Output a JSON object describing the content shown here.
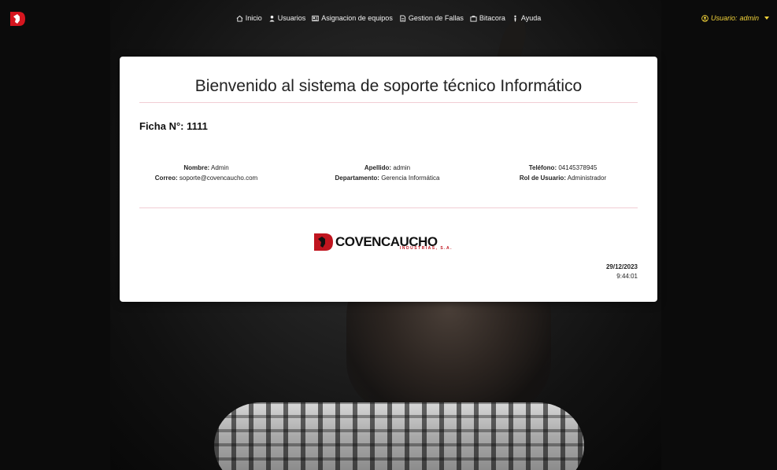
{
  "nav": {
    "items": [
      {
        "label": "Inicio",
        "icon": "home-icon"
      },
      {
        "label": "Usuarios",
        "icon": "user-icon"
      },
      {
        "label": "Asignacion de equipos",
        "icon": "id-card-icon"
      },
      {
        "label": "Gestion de Fallas",
        "icon": "document-icon"
      },
      {
        "label": "Bitacora",
        "icon": "briefcase-icon"
      },
      {
        "label": "Ayuda",
        "icon": "help-figure-icon"
      }
    ],
    "user": {
      "prefix": "Usuario:",
      "name": "admin"
    }
  },
  "card": {
    "title": "Bienvenido al sistema de soporte técnico Informático",
    "ficha": "Ficha N°: 1111",
    "fields": {
      "nombre_label": "Nombre:",
      "nombre": "Admin",
      "correo_label": "Correo:",
      "correo": "soporte@covencaucho.com",
      "apellido_label": "Apellido:",
      "apellido": "admin",
      "departamento_label": "Departamento:",
      "departamento": "Gerencia Informática",
      "telefono_label": "Teléfono:",
      "telefono": "04145378945",
      "rol_label": "Rol de Usuario:",
      "rol": "Administrador"
    },
    "brand": {
      "name": "COVENCAUCHO",
      "sub": "INDUSTRIAS, S.A."
    },
    "date": "29/12/2023",
    "time": "9:44:01"
  },
  "colors": {
    "accent": "#f2d33a",
    "brand_red": "#c0151f",
    "rule": "#f1cdd3"
  }
}
